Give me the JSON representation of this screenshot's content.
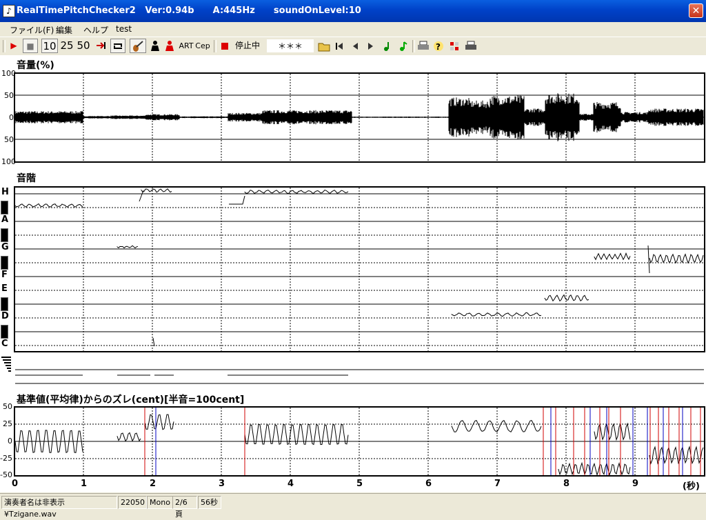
{
  "window": {
    "icon": "music-note-icon",
    "title": "RealTimePitchChecker2   Ver:0.94b      A:445Hz      soundOnLevel:10",
    "close": "✕"
  },
  "menu": [
    "ファイル(F)",
    "編集",
    "ヘルプ",
    "test"
  ],
  "toolbar": {
    "play": "▶",
    "stop": "■",
    "speed10": "10",
    "speed25": "25",
    "speed50": "50",
    "art": "ART",
    "cep": "Cep",
    "state": "停止中",
    "readout": "＊＊＊",
    "icons": [
      "play-icon",
      "stop-icon",
      "jump-end-icon",
      "loop-icon",
      "violin-icon",
      "person-icon",
      "person-red-icon",
      "record-stop-icon",
      "open-folder-icon",
      "skip-start-icon",
      "step-back-icon",
      "step-forward-icon",
      "note-green-icon",
      "note-green2-icon",
      "print-icon",
      "help-icon",
      "split-icon",
      "printer-icon"
    ]
  },
  "volume_panel": {
    "title": "音量(%)",
    "ylabels": [
      "100",
      "50",
      "0",
      "50",
      "100"
    ]
  },
  "pitch_panel": {
    "title": "音階",
    "notes": [
      "H",
      "A",
      "G",
      "F",
      "E",
      "D",
      "C"
    ]
  },
  "deviation_panel": {
    "title": "基準値(平均律)からのズレ(cent)[半音=100cent]",
    "ylabels": [
      "50",
      "25",
      "0",
      "-25",
      "-50"
    ]
  },
  "xaxis": {
    "ticks": [
      "0",
      "1",
      "2",
      "3",
      "4",
      "5",
      "6",
      "7",
      "8",
      "9"
    ],
    "unit": "(秒)"
  },
  "status": {
    "file": "演奏者名は非表示¥Tzigane.wav",
    "rate": "22050",
    "channels": "Mono",
    "page": "2/6頁",
    "duration": "56秒"
  },
  "colors": {
    "title": "#0a5fe0",
    "close": "#c8341a",
    "red_marker": "#d00000",
    "blue_marker": "#0000c0"
  }
}
